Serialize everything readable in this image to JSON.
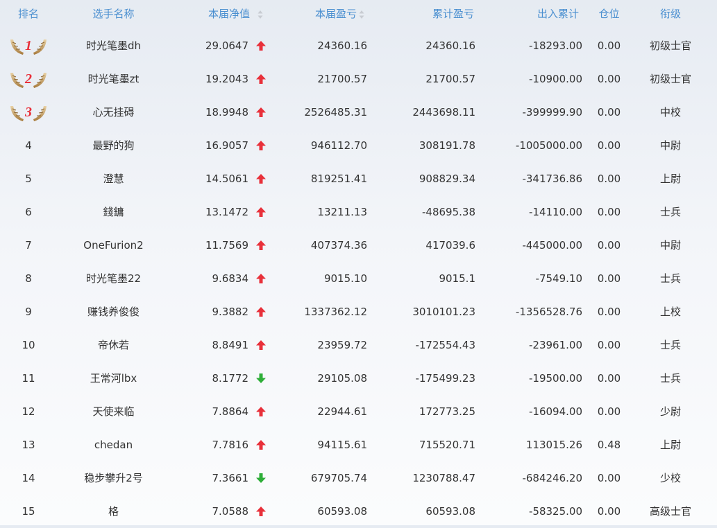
{
  "columns": {
    "rank": "排名",
    "name": "选手名称",
    "nav": "本届净值",
    "profit": "本届盈亏",
    "cumulative": "累计盈亏",
    "flow": "出入累计",
    "position": "仓位",
    "title": "衔级"
  },
  "colors": {
    "header_text": "#4a8fd0",
    "up_arrow": "#e8303a",
    "down_arrow": "#2eae38",
    "medal_gold": "#c7a163",
    "medal_number": "#e8303a"
  },
  "rows": [
    {
      "rank": "1",
      "medal": true,
      "name": "时光笔墨dh",
      "nav": "29.0647",
      "trend": "up",
      "profit": "24360.16",
      "cumulative": "24360.16",
      "flow": "-18293.00",
      "position": "0.00",
      "title": "初级士官"
    },
    {
      "rank": "2",
      "medal": true,
      "name": "时光笔墨zt",
      "nav": "19.2043",
      "trend": "up",
      "profit": "21700.57",
      "cumulative": "21700.57",
      "flow": "-10900.00",
      "position": "0.00",
      "title": "初级士官"
    },
    {
      "rank": "3",
      "medal": true,
      "name": "心无挂碍",
      "nav": "18.9948",
      "trend": "up",
      "profit": "2526485.31",
      "cumulative": "2443698.11",
      "flow": "-399999.90",
      "position": "0.00",
      "title": "中校"
    },
    {
      "rank": "4",
      "medal": false,
      "name": "最野的狗",
      "nav": "16.9057",
      "trend": "up",
      "profit": "946112.70",
      "cumulative": "308191.78",
      "flow": "-1005000.00",
      "position": "0.00",
      "title": "中尉"
    },
    {
      "rank": "5",
      "medal": false,
      "name": "澄慧",
      "nav": "14.5061",
      "trend": "up",
      "profit": "819251.41",
      "cumulative": "908829.34",
      "flow": "-341736.86",
      "position": "0.00",
      "title": "上尉"
    },
    {
      "rank": "6",
      "medal": false,
      "name": "錢鏞",
      "nav": "13.1472",
      "trend": "up",
      "profit": "13211.13",
      "cumulative": "-48695.38",
      "flow": "-14110.00",
      "position": "0.00",
      "title": "士兵"
    },
    {
      "rank": "7",
      "medal": false,
      "name": "OneFurion2",
      "nav": "11.7569",
      "trend": "up",
      "profit": "407374.36",
      "cumulative": "417039.6",
      "flow": "-445000.00",
      "position": "0.00",
      "title": "中尉"
    },
    {
      "rank": "8",
      "medal": false,
      "name": "时光笔墨22",
      "nav": "9.6834",
      "trend": "up",
      "profit": "9015.10",
      "cumulative": "9015.1",
      "flow": "-7549.10",
      "position": "0.00",
      "title": "士兵"
    },
    {
      "rank": "9",
      "medal": false,
      "name": "赚钱养俊俊",
      "nav": "9.3882",
      "trend": "up",
      "profit": "1337362.12",
      "cumulative": "3010101.23",
      "flow": "-1356528.76",
      "position": "0.00",
      "title": "上校"
    },
    {
      "rank": "10",
      "medal": false,
      "name": "帝休若",
      "nav": "8.8491",
      "trend": "up",
      "profit": "23959.72",
      "cumulative": "-172554.43",
      "flow": "-23961.00",
      "position": "0.00",
      "title": "士兵"
    },
    {
      "rank": "11",
      "medal": false,
      "name": "王常河lbx",
      "nav": "8.1772",
      "trend": "down",
      "profit": "29105.08",
      "cumulative": "-175499.23",
      "flow": "-19500.00",
      "position": "0.00",
      "title": "士兵"
    },
    {
      "rank": "12",
      "medal": false,
      "name": "天使来临",
      "nav": "7.8864",
      "trend": "up",
      "profit": "22944.61",
      "cumulative": "172773.25",
      "flow": "-16094.00",
      "position": "0.00",
      "title": "少尉"
    },
    {
      "rank": "13",
      "medal": false,
      "name": "chedan",
      "nav": "7.7816",
      "trend": "up",
      "profit": "94115.61",
      "cumulative": "715520.71",
      "flow": "113015.26",
      "position": "0.48",
      "title": "上尉"
    },
    {
      "rank": "14",
      "medal": false,
      "name": "稳步攀升2号",
      "nav": "7.3661",
      "trend": "down",
      "profit": "679705.74",
      "cumulative": "1230788.47",
      "flow": "-684246.20",
      "position": "0.00",
      "title": "少校"
    },
    {
      "rank": "15",
      "medal": false,
      "name": "格",
      "nav": "7.0588",
      "trend": "up",
      "profit": "60593.08",
      "cumulative": "60593.08",
      "flow": "-58325.00",
      "position": "0.00",
      "title": "高级士官"
    }
  ]
}
